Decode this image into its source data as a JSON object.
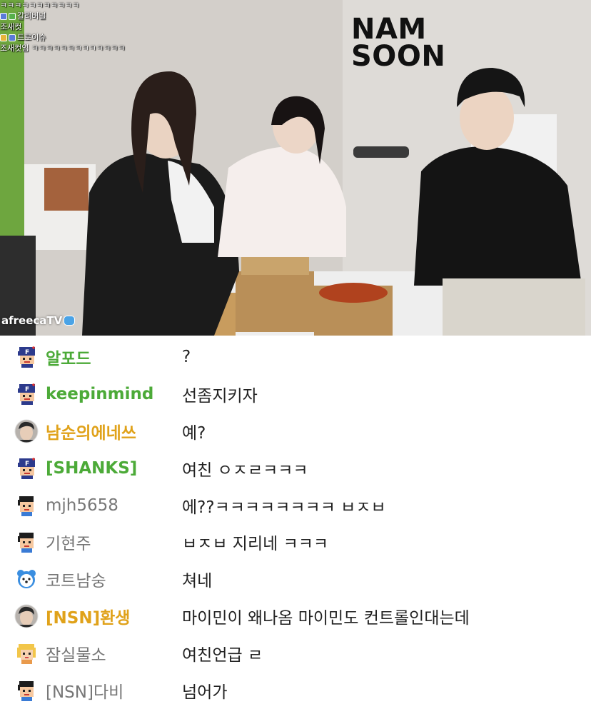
{
  "stream": {
    "sign_line1": "NAM",
    "sign_line2": "SOON",
    "platform_logo": "afreecaTV",
    "overlay_chat": [
      {
        "text": "ㅋㅋㅋㅋㅋㅋㅋㅋㅋㅋㅋ"
      },
      {
        "text": "갈리버널"
      },
      {
        "text": "조새컷"
      },
      {
        "text": "트로이슈"
      },
      {
        "text": "조새컷임 ㅋㅋㅋㅋㅋㅋㅋㅋㅋㅋㅋㅋㅋ"
      }
    ]
  },
  "chat": {
    "colors": {
      "fan_green": "#4caa38",
      "vip_gold": "#e0a21a",
      "normal_gray": "#777777",
      "message": "#222222"
    },
    "messages": [
      {
        "nick": "알포드",
        "text": "?",
        "nick_style": "fan",
        "avatar": "fan-badge-icon"
      },
      {
        "nick": "keepinmind",
        "text": "선좀지키자",
        "nick_style": "fan",
        "avatar": "fan-badge-icon"
      },
      {
        "nick": "남순의에네쓰",
        "text": "예?",
        "nick_style": "vip",
        "avatar": "profile-photo-icon"
      },
      {
        "nick": "[SHANKS]",
        "text": "여친 ㅇㅈㄹㅋㅋㅋ",
        "nick_style": "fan",
        "avatar": "fan-badge-icon"
      },
      {
        "nick": "mjh5658",
        "text": "에??ㅋㅋㅋㅋㅋㅋㅋㅋ ㅂㅈㅂ",
        "nick_style": "normal",
        "avatar": "pixel-face-icon"
      },
      {
        "nick": "기현주",
        "text": "ㅂㅈㅂ 지리네 ㅋㅋㅋ",
        "nick_style": "normal",
        "avatar": "pixel-face-icon"
      },
      {
        "nick": "코트남숭",
        "text": "쳐네",
        "nick_style": "normal",
        "avatar": "bear-face-icon"
      },
      {
        "nick": "[NSN]환생",
        "text": "마이민이 왜나옴 마이민도 컨트롤인대는데",
        "nick_style": "vip",
        "avatar": "profile-photo-icon"
      },
      {
        "nick": "잠실물소",
        "text": "여친언급 ㄹ",
        "nick_style": "normal",
        "avatar": "blonde-face-icon"
      },
      {
        "nick": "[NSN]다비",
        "text": "넘어가",
        "nick_style": "normal",
        "avatar": "pixel-face-icon"
      }
    ]
  }
}
